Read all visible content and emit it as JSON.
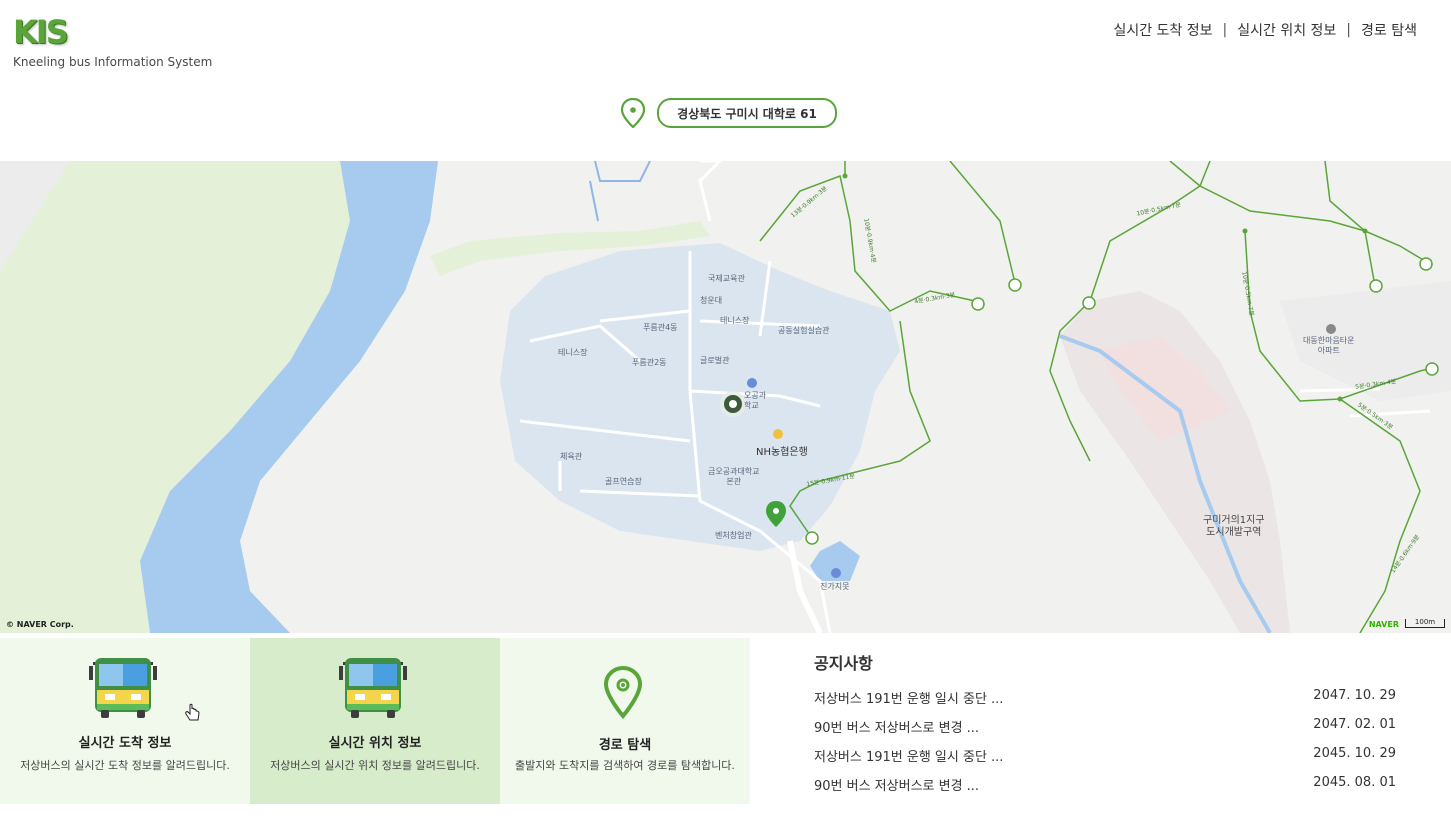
{
  "header": {
    "logo": "KIS",
    "subtitle": "Kneeling bus Information System",
    "nav": [
      {
        "label": "실시간 도착 정보"
      },
      {
        "label": "실시간 위치 정보"
      },
      {
        "label": "경로 탐색"
      }
    ],
    "separator": "|"
  },
  "location": {
    "address": "경상북도 구미시 대학로 61"
  },
  "map": {
    "copyright": "© NAVER Corp.",
    "brand": "NAVER",
    "scale": "100m",
    "labels": {
      "international": "국제교육관",
      "cheongun": "청운대",
      "tennis1": "테니스장",
      "pureum4": "푸름관4동",
      "tennis2": "테니스장",
      "pureum2": "푸름관2동",
      "global": "글로벌관",
      "lab": "공동실험실습관",
      "kit_partial": "오공과\n학교",
      "bank": "NH농협은행",
      "gym": "체육관",
      "golf": "골프연습장",
      "main_bldg": "금오공과대학교\n본관",
      "venture": "벤처창업관",
      "jingaji": "진가지못",
      "apartment": "대동한마음타운\n아파트",
      "district": "구미거의1지구\n도시개발구역"
    },
    "trail_labels": {
      "t1": "13분·0.9km·3분",
      "t2": "10분·0.9km·4분",
      "t3": "4분·0.3km·3분",
      "t4": "10분·0.5km·7분",
      "t5": "10분·0.5km·7분",
      "t6": "15분·0.9km·11분",
      "t7": "5분·0.3km·4분",
      "t8": "5분·0.5km·3분",
      "t9": "14분·0.6km·9분"
    }
  },
  "cards": [
    {
      "title": "실시간 도착 정보",
      "desc": "저상버스의 실시간 도착 정보를 알려드립니다.",
      "icon": "bus-icon"
    },
    {
      "title": "실시간 위치 정보",
      "desc": "저상버스의 실시간 위치 정보를 알려드립니다.",
      "icon": "bus-icon"
    },
    {
      "title": "경로 탐색",
      "desc": "출발지와 도착지를 검색하여 경로를 탐색합니다.",
      "icon": "location-pin-icon"
    }
  ],
  "notice": {
    "title": "공지사항",
    "items": [
      {
        "text": "저상버스 191번 운행 일시 중단 ...",
        "date": "2047. 10. 29"
      },
      {
        "text": "90번 버스 저상버스로 변경 ...",
        "date": "2047. 02. 01"
      },
      {
        "text": "저상버스 191번 운행 일시 중단 ...",
        "date": "2045. 10. 29"
      },
      {
        "text": "90번 버스 저상버스로 변경 ...",
        "date": "2045. 08. 01"
      }
    ]
  },
  "colors": {
    "brand_green": "#5aa53a",
    "card_bg": "#f1f9ec",
    "card_active_bg": "#d7eccb",
    "river": "#a6cbee",
    "campus": "#dbe5ef"
  }
}
